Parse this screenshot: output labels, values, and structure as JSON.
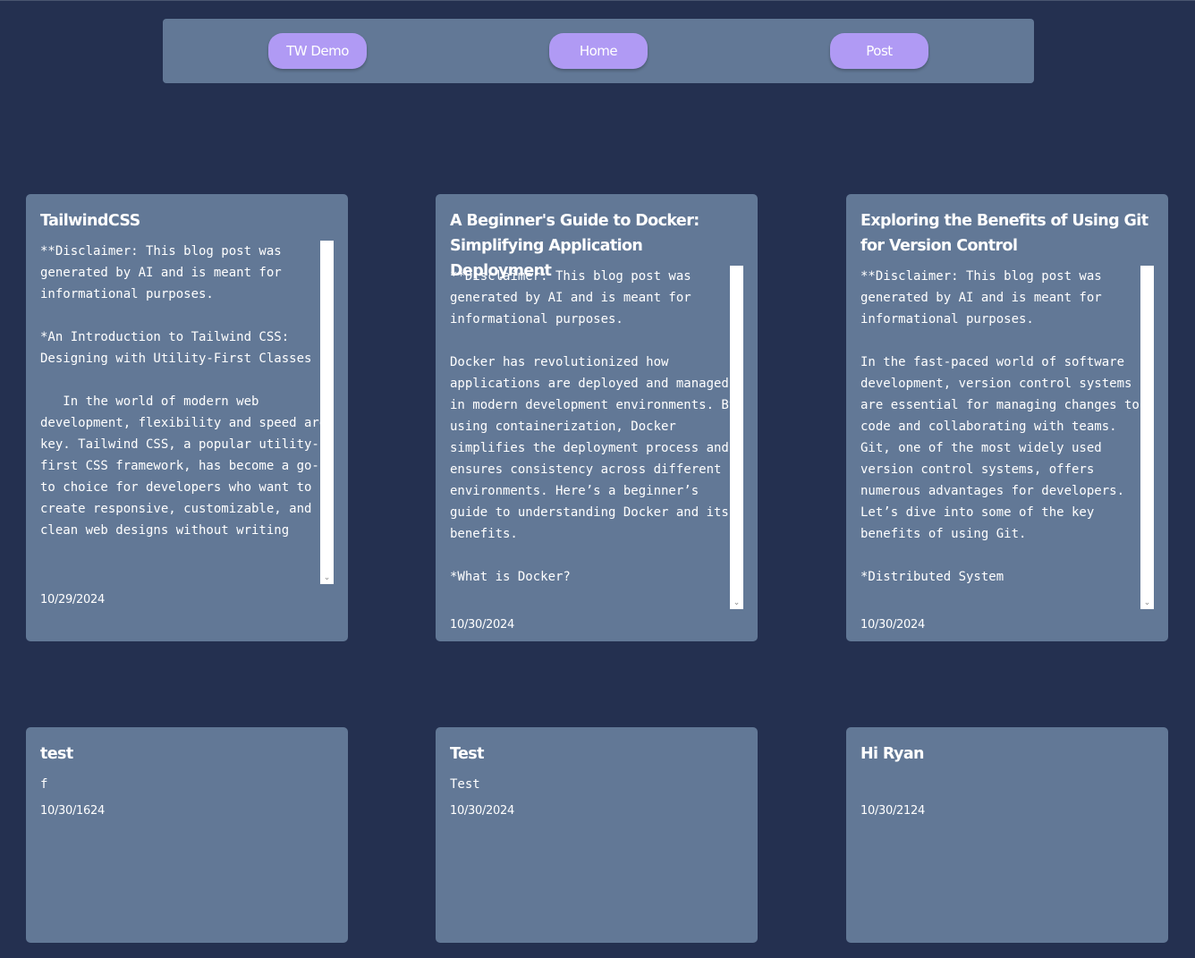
{
  "nav": {
    "items": [
      {
        "label": "TW Demo"
      },
      {
        "label": "Home"
      },
      {
        "label": "Post"
      }
    ]
  },
  "posts": [
    {
      "title": "TailwindCSS",
      "body": "**Disclaimer: This blog post was generated by AI and is meant for informational purposes.\n\n*An Introduction to Tailwind CSS: Designing with Utility-First Classes\n\n   In the world of modern web development, flexibility and speed are key. Tailwind CSS, a popular utility-first CSS framework, has become a go-to choice for developers who want to create responsive, customizable, and clean web designs without writing",
      "date": "10/29/2024"
    },
    {
      "title": "A Beginner's Guide to Docker: Simplifying Application Deployment",
      "body": "**Disclaimer: This blog post was generated by AI and is meant for informational purposes.\n\nDocker has revolutionized how applications are deployed and managed in modern development environments. By using containerization, Docker simplifies the deployment process and ensures consistency across different environments. Here’s a beginner’s guide to understanding Docker and its benefits.\n\n*What is Docker?",
      "date": "10/30/2024"
    },
    {
      "title": "Exploring the Benefits of Using Git for Version Control",
      "body": "**Disclaimer: This blog post was generated by AI and is meant for informational purposes.\n\nIn the fast-paced world of software development, version control systems are essential for managing changes to code and collaborating with teams. Git, one of the most widely used version control systems, offers numerous advantages for developers. Let’s dive into some of the key benefits of using Git.\n\n*Distributed System",
      "date": "10/30/2024"
    },
    {
      "title": "test",
      "body": "f",
      "date": "10/30/1624"
    },
    {
      "title": "Test",
      "body": "Test",
      "date": "10/30/2024"
    },
    {
      "title": "Hi Ryan",
      "body": "",
      "date": "10/30/2124",
      "icon": "clown-face-emoji"
    }
  ],
  "colors": {
    "background": "#243050",
    "card": "#627896",
    "button": "#b09af4",
    "text": "#ffffff"
  }
}
